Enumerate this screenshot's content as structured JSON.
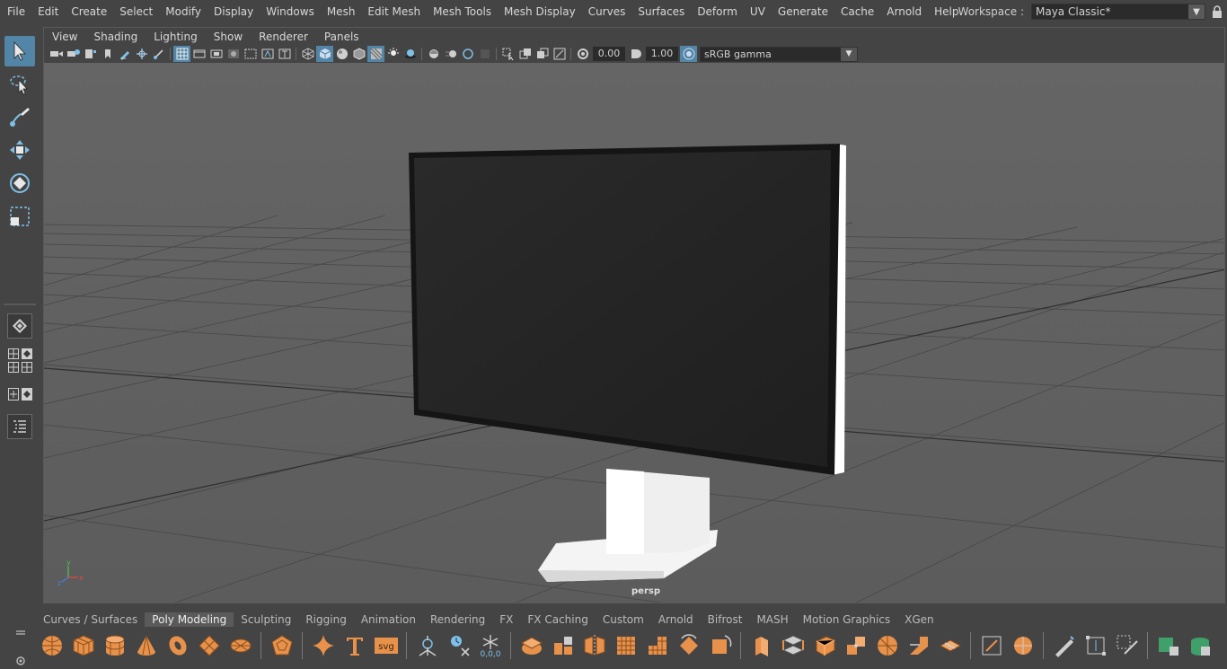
{
  "menubar": {
    "items": [
      "File",
      "Edit",
      "Create",
      "Select",
      "Modify",
      "Display",
      "Windows",
      "Mesh",
      "Edit Mesh",
      "Mesh Tools",
      "Mesh Display",
      "Curves",
      "Surfaces",
      "Deform",
      "UV",
      "Generate",
      "Cache",
      "Arnold",
      "Help"
    ]
  },
  "workspace": {
    "label": "Workspace :",
    "value": "Maya Classic*"
  },
  "panel_menu": {
    "items": [
      "View",
      "Shading",
      "Lighting",
      "Show",
      "Renderer",
      "Panels"
    ]
  },
  "panel_toolbar": {
    "exposure": "0.00",
    "gamma": "1.00",
    "color_space": "sRGB gamma"
  },
  "viewport": {
    "camera_label": "persp",
    "axis_labels": {
      "y": "y",
      "x": "x",
      "z": "z"
    }
  },
  "shelf": {
    "tabs": [
      "Curves / Surfaces",
      "Poly Modeling",
      "Sculpting",
      "Rigging",
      "Animation",
      "Rendering",
      "FX",
      "FX Caching",
      "Custom",
      "Arnold",
      "Bifrost",
      "MASH",
      "Motion Graphics",
      "XGen"
    ],
    "active_tab": "Poly Modeling",
    "svg_label": "svg",
    "coord_label": "0,0,0"
  },
  "colors": {
    "background": "#444444",
    "viewport": "#5f5f5f",
    "accent": "#5285a6",
    "shelf_icon": "#e8914a"
  }
}
